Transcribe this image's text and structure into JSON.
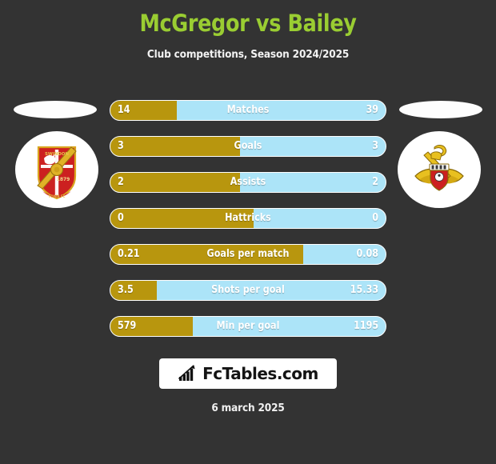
{
  "header": {
    "title": "McGregor vs Bailey",
    "subtitle": "Club competitions, Season 2024/2025",
    "title_color": "#9ACD32"
  },
  "theme": {
    "background": "#333333",
    "home_color": "#B8960E",
    "away_color": "#ACE4F8",
    "text_color": "#FFFFFF"
  },
  "crests": {
    "home": {
      "name": "swindon-town-crest",
      "founded": "1879"
    },
    "away": {
      "name": "doncaster-rovers-crest"
    }
  },
  "chart_data": {
    "type": "bar",
    "title": "McGregor vs Bailey",
    "subtitle": "Club competitions, Season 2024/2025",
    "orientation": "horizontal-diverging",
    "legend": [
      "McGregor",
      "Bailey"
    ],
    "categories": [
      "Matches",
      "Goals",
      "Assists",
      "Hattricks",
      "Goals per match",
      "Shots per goal",
      "Min per goal"
    ],
    "series": [
      {
        "name": "McGregor",
        "color": "#B8960E",
        "values": [
          "14",
          "3",
          "2",
          "0",
          "0.21",
          "3.5",
          "579"
        ],
        "fill_percent": [
          24,
          47,
          47,
          52,
          70,
          17,
          30
        ]
      },
      {
        "name": "Bailey",
        "color": "#ACE4F8",
        "values": [
          "39",
          "3",
          "2",
          "0",
          "0.08",
          "15.33",
          "1195"
        ],
        "fill_percent": [
          76,
          53,
          53,
          48,
          30,
          83,
          70
        ]
      }
    ]
  },
  "rows": [
    {
      "label": "Matches",
      "home": "14",
      "away": "39",
      "fill": 24
    },
    {
      "label": "Goals",
      "home": "3",
      "away": "3",
      "fill": 47
    },
    {
      "label": "Assists",
      "home": "2",
      "away": "2",
      "fill": 47
    },
    {
      "label": "Hattricks",
      "home": "0",
      "away": "0",
      "fill": 52
    },
    {
      "label": "Goals per match",
      "home": "0.21",
      "away": "0.08",
      "fill": 70
    },
    {
      "label": "Shots per goal",
      "home": "3.5",
      "away": "15.33",
      "fill": 17
    },
    {
      "label": "Min per goal",
      "home": "579",
      "away": "1195",
      "fill": 30
    }
  ],
  "footer": {
    "brand": "FcTables.com",
    "brand_icon": "bar-chart-growth-icon",
    "date": "6 march 2025"
  }
}
